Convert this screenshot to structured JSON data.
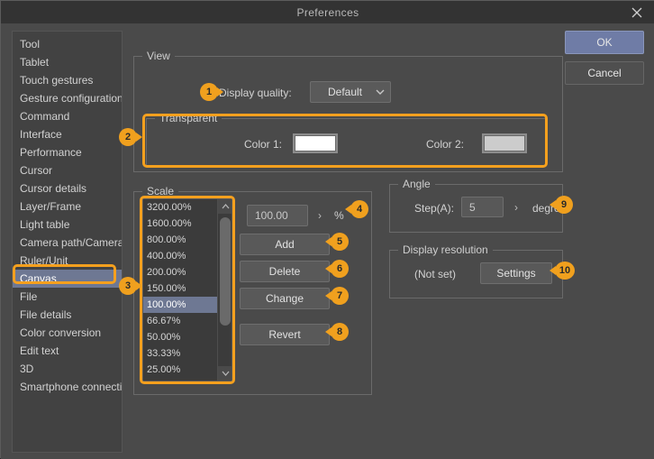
{
  "window": {
    "title": "Preferences",
    "close_icon": "close-icon"
  },
  "buttons": {
    "ok": "OK",
    "cancel": "Cancel"
  },
  "sidebar": {
    "items": [
      {
        "label": "Tool",
        "selected": false
      },
      {
        "label": "Tablet",
        "selected": false
      },
      {
        "label": "Touch gestures",
        "selected": false
      },
      {
        "label": "Gesture configuration",
        "selected": false
      },
      {
        "label": "Command",
        "selected": false
      },
      {
        "label": "Interface",
        "selected": false
      },
      {
        "label": "Performance",
        "selected": false
      },
      {
        "label": "Cursor",
        "selected": false
      },
      {
        "label": "Cursor details",
        "selected": false
      },
      {
        "label": "Layer/Frame",
        "selected": false
      },
      {
        "label": "Light table",
        "selected": false
      },
      {
        "label": "Camera path/Camera",
        "selected": false
      },
      {
        "label": "Ruler/Unit",
        "selected": false
      },
      {
        "label": "Canvas",
        "selected": true
      },
      {
        "label": "File",
        "selected": false
      },
      {
        "label": "File details",
        "selected": false
      },
      {
        "label": "Color conversion",
        "selected": false
      },
      {
        "label": "Edit text",
        "selected": false
      },
      {
        "label": "3D",
        "selected": false
      },
      {
        "label": "Smartphone connection",
        "selected": false
      }
    ]
  },
  "view": {
    "title": "View",
    "display_quality_label": "Display quality:",
    "display_quality_value": "Default",
    "chevron_icon": "chevron-down-icon",
    "transparent": {
      "title": "Transparent",
      "color1_label": "Color 1:",
      "color1_value": "#FFFFFF",
      "color2_label": "Color 2:",
      "color2_value": "#CCCCCC"
    }
  },
  "scale": {
    "title": "Scale",
    "list": [
      {
        "label": "3200.00%",
        "selected": false
      },
      {
        "label": "1600.00%",
        "selected": false
      },
      {
        "label": "800.00%",
        "selected": false
      },
      {
        "label": "400.00%",
        "selected": false
      },
      {
        "label": "200.00%",
        "selected": false
      },
      {
        "label": "150.00%",
        "selected": false
      },
      {
        "label": "100.00%",
        "selected": true
      },
      {
        "label": "66.67%",
        "selected": false
      },
      {
        "label": "50.00%",
        "selected": false
      },
      {
        "label": "33.33%",
        "selected": false
      },
      {
        "label": "25.00%",
        "selected": false
      }
    ],
    "value_field": "100.00",
    "stepper_icon": "chevron-right-icon",
    "unit": "%",
    "add": "Add",
    "delete": "Delete",
    "change": "Change",
    "revert": "Revert",
    "scroll_up_icon": "chevron-up-icon",
    "scroll_down_icon": "chevron-down-icon"
  },
  "angle": {
    "title": "Angle",
    "step_label": "Step(A):",
    "step_value": "5",
    "stepper_icon": "chevron-right-icon",
    "unit": "degree"
  },
  "display_resolution": {
    "title": "Display resolution",
    "status": "(Not set)",
    "settings_button": "Settings"
  },
  "badges": [
    {
      "n": "1"
    },
    {
      "n": "2"
    },
    {
      "n": "3"
    },
    {
      "n": "4"
    },
    {
      "n": "5"
    },
    {
      "n": "6"
    },
    {
      "n": "7"
    },
    {
      "n": "8"
    },
    {
      "n": "9"
    },
    {
      "n": "10"
    }
  ],
  "colors": {
    "accent": "#f0a01e",
    "selection": "#6e7893",
    "primary_button": "#6f7ca6",
    "window_bg": "#4a4a4a",
    "titlebar_bg": "#333333"
  }
}
